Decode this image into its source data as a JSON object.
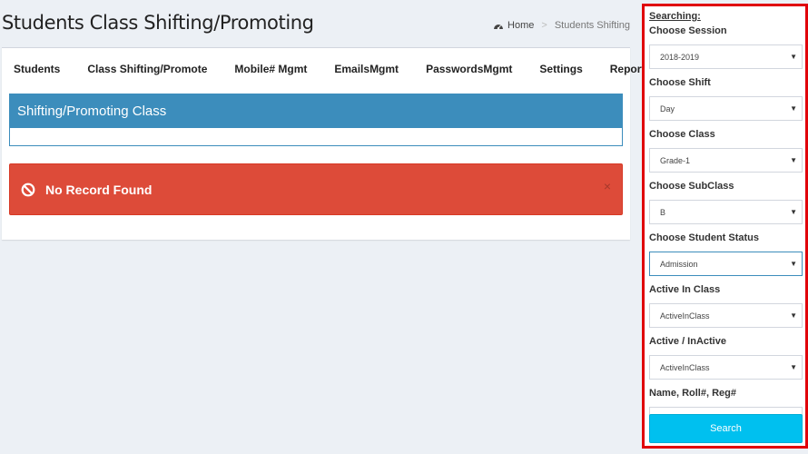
{
  "header": {
    "title": "Students Class Shifting/Promoting",
    "breadcrumb": {
      "home": "Home",
      "current": "Students Shifting"
    }
  },
  "nav": {
    "items": [
      {
        "label": "Students"
      },
      {
        "label": "Class Shifting/Promote"
      },
      {
        "label": "Mobile# Mgmt"
      },
      {
        "label": "EmailsMgmt"
      },
      {
        "label": "PasswordsMgmt"
      },
      {
        "label": "Settings"
      },
      {
        "label": "Reports"
      }
    ]
  },
  "panel": {
    "title": "Shifting/Promoting Class"
  },
  "alert": {
    "message": "No Record Found",
    "close": "×",
    "color": "#dd4b39"
  },
  "search": {
    "heading": "Searching:",
    "session": {
      "label": "Choose Session",
      "value": "2018-2019"
    },
    "shift": {
      "label": "Choose Shift",
      "value": "Day"
    },
    "class": {
      "label": "Choose Class",
      "value": "Grade-1"
    },
    "subclass": {
      "label": "Choose SubClass",
      "value": "B"
    },
    "status": {
      "label": "Choose Student Status",
      "value": "Admission"
    },
    "active_class": {
      "label": "Active In Class",
      "value": "ActiveInClass"
    },
    "active_inactive": {
      "label": "Active / InActive",
      "value": "ActiveInClass"
    },
    "name_roll": {
      "label": "Name, Roll#, Reg#",
      "value": ""
    },
    "button": "Search",
    "caret": "▼"
  },
  "colors": {
    "primary": "#3c8dbc",
    "danger": "#dd4b39",
    "info": "#00c0ef",
    "highlight_border": "#e0000a"
  }
}
